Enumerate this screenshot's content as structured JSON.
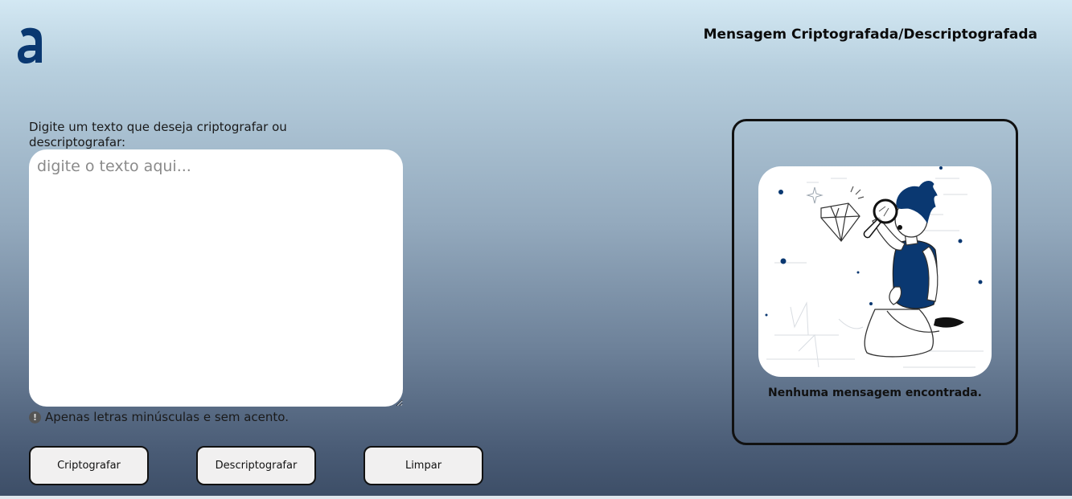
{
  "header": {
    "logo_icon": "alura-a-logo-icon",
    "title": "Mensagem Criptografada/Descriptografada"
  },
  "input": {
    "label": "Digite um texto que deseja criptografar ou descriptografar:",
    "placeholder": "digite o texto aqui...",
    "value": ""
  },
  "hint": {
    "icon": "exclamation-circle-icon",
    "text": "Apenas letras minúsculas e sem acento."
  },
  "buttons": {
    "encrypt": "Criptografar",
    "decrypt": "Descriptografar",
    "clear": "Limpar"
  },
  "output": {
    "illustration_icon": "person-magnifier-diamond-illustration",
    "empty_message": "Nenhuma mensagem encontrada."
  },
  "colors": {
    "brand_blue": "#0a3871",
    "background_top": "#d3e8f3",
    "background_bottom": "#3c4d66",
    "button_bg": "#f1f0f0"
  }
}
